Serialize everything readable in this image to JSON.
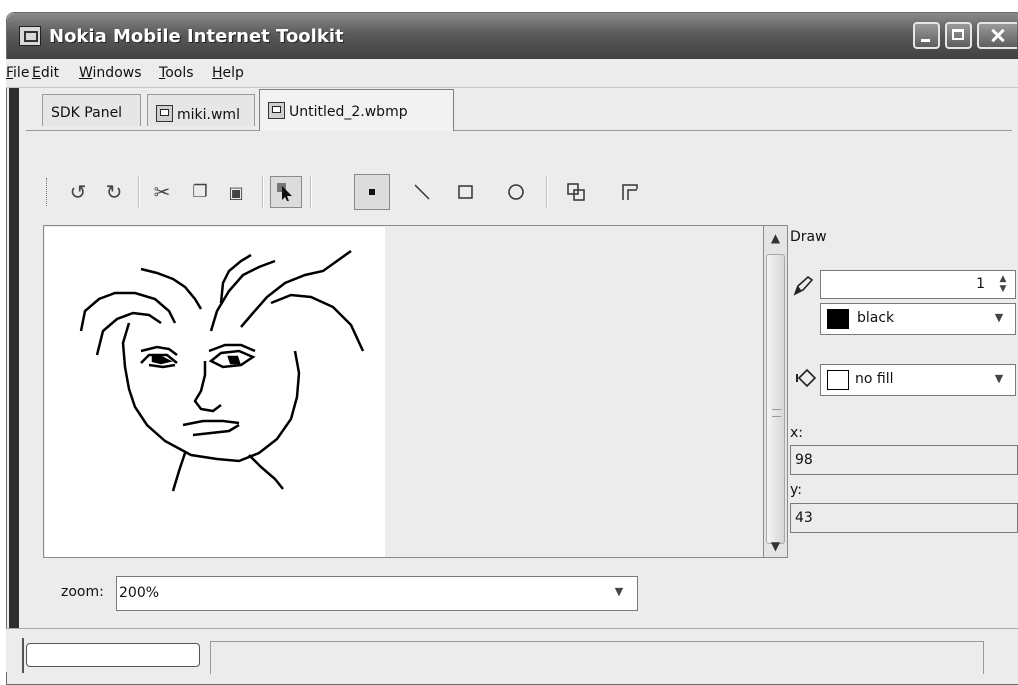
{
  "window": {
    "title": "Nokia Mobile Internet Toolkit",
    "controls": [
      "minimize-icon",
      "maximize-icon",
      "close-icon"
    ]
  },
  "menubar": {
    "items": [
      {
        "mnemonic": "F",
        "rest": "ile"
      },
      {
        "mnemonic": "",
        "pre": "E",
        "rest": "dit"
      },
      {
        "mnemonic": "W",
        "rest": "indows"
      },
      {
        "mnemonic": "T",
        "rest": "ools"
      },
      {
        "mnemonic": "H",
        "rest": "elp"
      }
    ]
  },
  "tabs": [
    {
      "label": "SDK Panel",
      "icon": null
    },
    {
      "label": "miki.wml",
      "icon": "wml-file-icon"
    },
    {
      "label": "Untitled_2.wbmp",
      "icon": "wbmp-file-icon",
      "active": true
    }
  ],
  "toolbar": {
    "buttons": [
      {
        "name": "undo-icon",
        "glyph": "↺"
      },
      {
        "name": "redo-icon",
        "glyph": "↻"
      },
      {
        "name": "cut-icon",
        "glyph": "✂"
      },
      {
        "name": "copy-icon",
        "glyph": "❐"
      },
      {
        "name": "paste-icon",
        "glyph": "📋"
      },
      {
        "name": "select-arrow-icon",
        "glyph": "➤",
        "pressed": true
      },
      {
        "name": "point-tool-icon",
        "glyph": "▪",
        "pressed": true
      },
      {
        "name": "line-tool-icon",
        "glyph": "╲"
      },
      {
        "name": "rectangle-tool-icon",
        "glyph": "□"
      },
      {
        "name": "ellipse-tool-icon",
        "glyph": "○"
      },
      {
        "name": "resize-canvas-icon",
        "glyph": "⧉"
      },
      {
        "name": "crop-icon",
        "glyph": "⌜"
      }
    ]
  },
  "draw_panel": {
    "title": "Draw",
    "pen_width": "1",
    "stroke_color": {
      "label": "black",
      "swatch": "#000000"
    },
    "fill": {
      "label": "no fill",
      "swatch": "#ffffff"
    },
    "x_label": "x:",
    "x_value": "98",
    "y_label": "y:",
    "y_value": "43"
  },
  "zoom": {
    "label": "zoom:",
    "value": "200%"
  }
}
